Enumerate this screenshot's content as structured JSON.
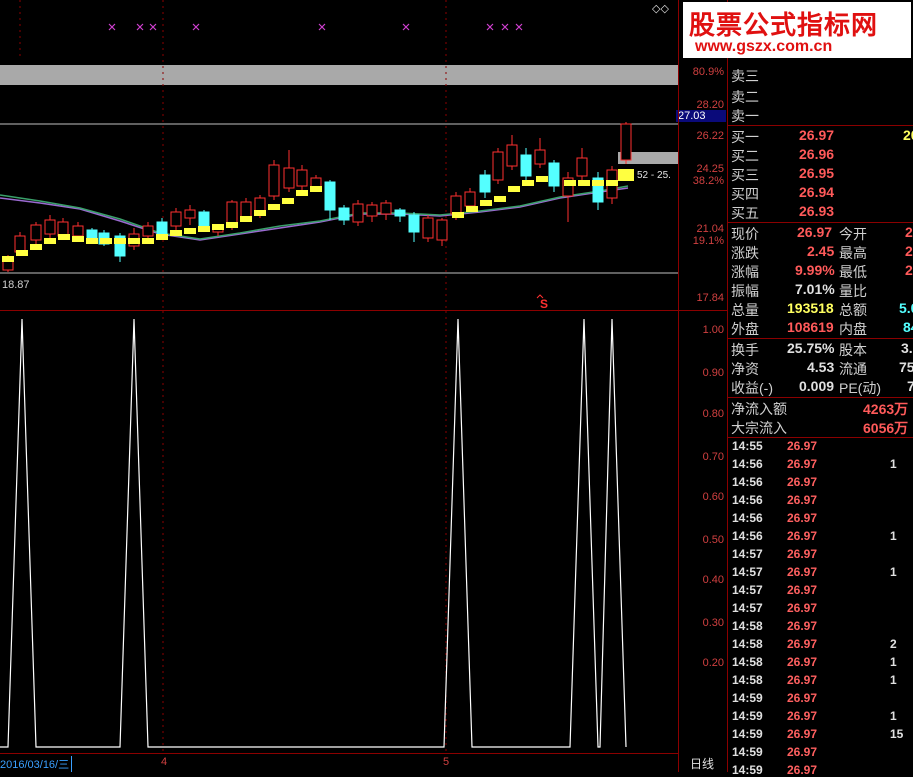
{
  "price_axis": {
    "labels": [
      "80.9%",
      "28.20",
      "27.03",
      "26.22",
      "24.25",
      "38.2%",
      "21.04",
      "19.1%",
      "17.84"
    ],
    "current_label": "27.03"
  },
  "indicator_axis": {
    "labels": [
      "1.00",
      "0.90",
      "0.80",
      "0.70",
      "0.60",
      "0.50",
      "0.40",
      "0.30",
      "0.20"
    ]
  },
  "chart": {
    "low_label": "18.87",
    "marker_label": "S",
    "range_label": "52 - 25."
  },
  "date_bar": {
    "date": "2016/03/16/三",
    "month_4": "4",
    "month_5": "5",
    "period": "日线"
  },
  "watermark": {
    "title": "股票公式指标网",
    "url": "www.gszx.com.cn"
  },
  "order_book": {
    "sell": [
      {
        "label": "卖三"
      },
      {
        "label": "卖二"
      },
      {
        "label": "卖一"
      }
    ],
    "buy": [
      {
        "label": "买一",
        "price": "26.97",
        "volume": "20"
      },
      {
        "label": "买二",
        "price": "26.96"
      },
      {
        "label": "买三",
        "price": "26.95"
      },
      {
        "label": "买四",
        "price": "26.94"
      },
      {
        "label": "买五",
        "price": "26.93"
      }
    ]
  },
  "quote": {
    "current_label": "现价",
    "current_value": "26.97",
    "open_label": "今开",
    "open_value": "2",
    "change_label": "涨跌",
    "change_value": "2.45",
    "high_label": "最高",
    "high_value": "2",
    "pct_label": "涨幅",
    "pct_value": "9.99%",
    "low_label": "最低",
    "low_value": "2",
    "amp_label": "振幅",
    "amp_value": "7.01%",
    "ratio_label": "量比",
    "vol_label": "总量",
    "vol_value": "193518",
    "amount_label": "总额",
    "amount_value": "5.0",
    "outer_label": "外盘",
    "outer_value": "108619",
    "inner_label": "内盘",
    "inner_value": "84",
    "turnover_label": "换手",
    "turnover_value": "25.75%",
    "capital_label": "股本",
    "capital_value": "3.0",
    "nav_label": "净资",
    "nav_value": "4.53",
    "float_label": "流通",
    "float_value": "75",
    "eps_label": "收益(-)",
    "eps_value": "0.009",
    "pe_label": "PE(动)",
    "pe_value": "7"
  },
  "flow": {
    "net_label": "净流入额",
    "net_value": "4263万",
    "block_label": "大宗流入",
    "block_value": "6056万"
  },
  "ticks": [
    {
      "time": "14:55",
      "price": "26.97",
      "vol": ""
    },
    {
      "time": "14:56",
      "price": "26.97",
      "vol": "1"
    },
    {
      "time": "14:56",
      "price": "26.97",
      "vol": ""
    },
    {
      "time": "14:56",
      "price": "26.97",
      "vol": ""
    },
    {
      "time": "14:56",
      "price": "26.97",
      "vol": ""
    },
    {
      "time": "14:56",
      "price": "26.97",
      "vol": "1"
    },
    {
      "time": "14:57",
      "price": "26.97",
      "vol": ""
    },
    {
      "time": "14:57",
      "price": "26.97",
      "vol": "1"
    },
    {
      "time": "14:57",
      "price": "26.97",
      "vol": ""
    },
    {
      "time": "14:57",
      "price": "26.97",
      "vol": ""
    },
    {
      "time": "14:58",
      "price": "26.97",
      "vol": ""
    },
    {
      "time": "14:58",
      "price": "26.97",
      "vol": "2"
    },
    {
      "time": "14:58",
      "price": "26.97",
      "vol": "1"
    },
    {
      "time": "14:58",
      "price": "26.97",
      "vol": "1"
    },
    {
      "time": "14:59",
      "price": "26.97",
      "vol": ""
    },
    {
      "time": "14:59",
      "price": "26.97",
      "vol": "1"
    },
    {
      "time": "14:59",
      "price": "26.97",
      "vol": "15"
    },
    {
      "time": "14:59",
      "price": "26.97",
      "vol": ""
    },
    {
      "time": "14:59",
      "price": "26.97",
      "vol": ""
    }
  ],
  "colors": {
    "up": "#ff3030",
    "down": "#54ffff",
    "signal": "#ffff40",
    "frame": "#8b0000"
  }
}
